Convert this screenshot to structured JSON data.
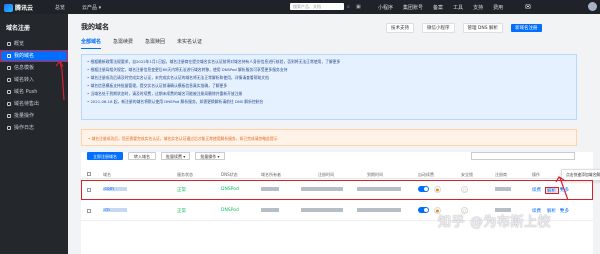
{
  "topbar": {
    "brand": "腾讯云",
    "home": "总览",
    "console": "云产品",
    "search_placeholder": "搜索产品、文档",
    "icons": [
      "mini-program-icon",
      "notification-icon"
    ],
    "links": [
      "小程序",
      "集团账号",
      "备案",
      "工具",
      "支持",
      "费用"
    ]
  },
  "sidebar": {
    "title": "域名注册",
    "items": [
      {
        "label": "概览",
        "active": false
      },
      {
        "label": "我的域名",
        "active": true
      },
      {
        "label": "信息模板",
        "active": false
      },
      {
        "label": "域名转入",
        "active": false
      },
      {
        "label": "域名 Push",
        "active": false
      },
      {
        "label": "域名待售出",
        "active": false
      },
      {
        "label": "批量操作",
        "active": false
      },
      {
        "label": "操作日志",
        "active": false
      }
    ]
  },
  "main": {
    "title": "我的域名",
    "actions": [
      "技术支持",
      "微信小程序",
      "管理 DNS 解析",
      "新域名注册"
    ],
    "tabs": [
      {
        "label": "全部域名",
        "active": true
      },
      {
        "label": "急需续费",
        "active": false
      },
      {
        "label": "急需赎回",
        "active": false
      },
      {
        "label": "未实名认证",
        "active": false
      }
    ],
    "notices": [
      "• 根据最新政策法规要求，自2022年1月1日起，域名注册商在提交域名实名认证前将对域名持有人身份信息进行核验，否则将无法正常使用，了解更多",
      "• 根据注册局相关规定，域名注册信息变更后60天内将无法进行域名转移，使用 DNSPod 解析服务可享受更多服务支持",
      "• 域名注册成功后请及时完成实名认证，未完成实名认证的域名将无法正常解析和使用，详情请查看帮助文档",
      "• 域名信息模板支持批量管理，提交实名认证前请确认模板信息真实准确，了解更多",
      "• 当域名处于到期状态时，请及时续费，过期未续费的域名可能被注册局删除并重新开放注册",
      "• 2021-06-18 起，新注册的域名将默认使用 DNSPod 解析服务，如需更换解析请前往 DNS 解析控制台"
    ],
    "warning": "• 域名注册成功后，您还需要完成实名认证，域名实名认证通过后才能正常使用解析服务，如已完成请忽略此提示",
    "toolbar": {
      "register": "立即注册域名",
      "transfer": "转入域名",
      "renew": "批量续费",
      "batch": "批量操作"
    },
    "columns": [
      "域名",
      "服务状态",
      "DNS状态",
      "域名所有者",
      "注册时间",
      "到期时间",
      "自动续费",
      "安全锁",
      "注册商",
      "操作"
    ],
    "rows": [
      {
        "domain_suffix": ".com",
        "status": "正常",
        "dns": "DNSPod",
        "ops": [
          "续费",
          "解析",
          "更多"
        ]
      },
      {
        "domain_suffix": ".cn",
        "status": "正常",
        "dns": "DNSPod",
        "ops": [
          "续费",
          "解析",
          "更多"
        ]
      }
    ],
    "tooltip": "点击快速添加域名解析"
  },
  "watermark": "知乎 @为布斯上校",
  "colors": {
    "accent": "#006eff",
    "annotation": "#d8202c",
    "ok": "#0abf5b"
  }
}
